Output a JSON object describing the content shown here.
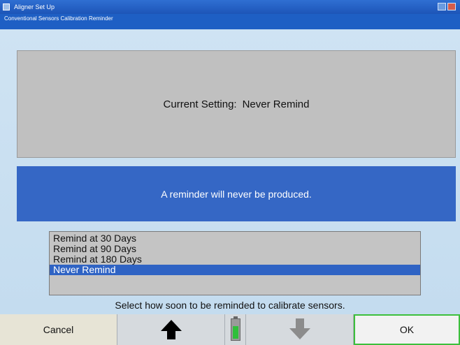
{
  "window": {
    "title": "Aligner Set Up",
    "subtitle": "Conventional Sensors Calibration Reminder"
  },
  "setting": {
    "label": "Current Setting:",
    "value": "Never Remind"
  },
  "info": {
    "message": "A reminder will never be produced."
  },
  "options": [
    {
      "label": "Remind at 30 Days",
      "selected": false
    },
    {
      "label": "Remind at 90 Days",
      "selected": false
    },
    {
      "label": "Remind at 180 Days",
      "selected": false
    },
    {
      "label": "Never Remind",
      "selected": true
    }
  ],
  "instruction": "Select how soon to be reminded to calibrate sensors.",
  "buttons": {
    "cancel": "Cancel",
    "ok": "OK"
  },
  "icons": {
    "up": "arrow-up-icon",
    "down": "arrow-down-icon",
    "battery": "battery-icon"
  },
  "colors": {
    "titlebar": "#1d55b8",
    "info_panel": "#3567c5",
    "selection": "#2f63c4",
    "ok_border": "#3cbf3c"
  }
}
